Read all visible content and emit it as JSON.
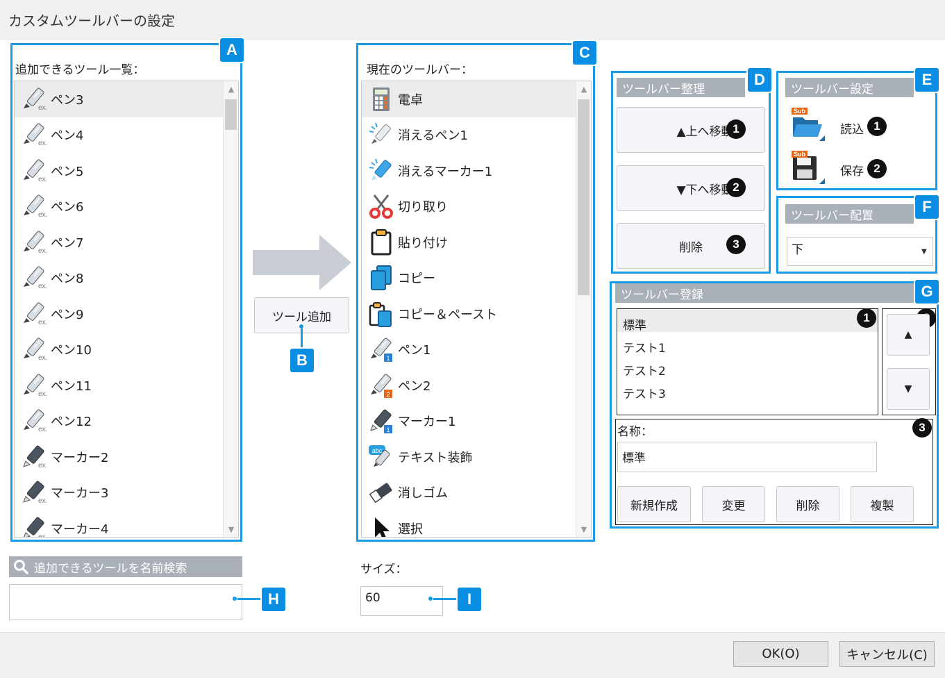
{
  "window": {
    "title": "カスタムツールバーの設定"
  },
  "available": {
    "label": "追加できるツール一覧：",
    "items": [
      {
        "label": "ペン3",
        "icon": "pen-ex-icon"
      },
      {
        "label": "ペン4",
        "icon": "pen-ex-icon"
      },
      {
        "label": "ペン5",
        "icon": "pen-ex-icon"
      },
      {
        "label": "ペン6",
        "icon": "pen-ex-icon"
      },
      {
        "label": "ペン7",
        "icon": "pen-ex-icon"
      },
      {
        "label": "ペン8",
        "icon": "pen-ex-icon"
      },
      {
        "label": "ペン9",
        "icon": "pen-ex-icon"
      },
      {
        "label": "ペン10",
        "icon": "pen-ex-icon"
      },
      {
        "label": "ペン11",
        "icon": "pen-ex-icon"
      },
      {
        "label": "ペン12",
        "icon": "pen-ex-icon"
      },
      {
        "label": "マーカー2",
        "icon": "marker-ex-icon"
      },
      {
        "label": "マーカー3",
        "icon": "marker-ex-icon"
      },
      {
        "label": "マーカー4",
        "icon": "marker-ex-icon"
      }
    ]
  },
  "add_button": {
    "label": "ツール追加"
  },
  "current": {
    "label": "現在のツールバー：",
    "items": [
      {
        "label": "電卓",
        "icon": "calculator-icon"
      },
      {
        "label": "消えるペン1",
        "icon": "vanishing-pen-icon"
      },
      {
        "label": "消えるマーカー1",
        "icon": "vanishing-marker-icon"
      },
      {
        "label": "切り取り",
        "icon": "scissors-icon"
      },
      {
        "label": "貼り付け",
        "icon": "paste-icon"
      },
      {
        "label": "コピー",
        "icon": "copy-icon"
      },
      {
        "label": "コピー＆ペースト",
        "icon": "copy-paste-icon"
      },
      {
        "label": "ペン1",
        "icon": "pen-1-icon"
      },
      {
        "label": "ペン2",
        "icon": "pen-2-icon"
      },
      {
        "label": "マーカー1",
        "icon": "marker-1-icon"
      },
      {
        "label": "テキスト装飾",
        "icon": "text-decoration-icon"
      },
      {
        "label": "消しゴム",
        "icon": "eraser-icon"
      },
      {
        "label": "選択",
        "icon": "cursor-arrow-icon"
      }
    ]
  },
  "organize": {
    "header": "ツールバー整理",
    "move_up": "▲上へ移動",
    "move_down": "▼下へ移動",
    "delete": "削除"
  },
  "settings": {
    "header": "ツールバー設定",
    "load": "読込",
    "save": "保存",
    "sub_badge": "Sub"
  },
  "placement": {
    "header": "ツールバー配置",
    "value": "下"
  },
  "register": {
    "header": "ツールバー登録",
    "items": [
      "標準",
      "テスト1",
      "テスト2",
      "テスト3"
    ],
    "name_label": "名称：",
    "name_value": "標準",
    "buttons": {
      "new": "新規作成",
      "change": "変更",
      "delete": "削除",
      "duplicate": "複製"
    },
    "up_arrow": "▲",
    "down_arrow": "▼"
  },
  "search": {
    "label": "追加できるツールを名前検索",
    "value": ""
  },
  "size": {
    "label": "サイズ：",
    "value": "60"
  },
  "footer": {
    "ok": "OK(O)",
    "cancel": "キャンセル(C)"
  },
  "callouts": {
    "A": "A",
    "B": "B",
    "C": "C",
    "D": "D",
    "E": "E",
    "F": "F",
    "G": "G",
    "H": "H",
    "I": "I"
  },
  "numbers": {
    "n1": "1",
    "n2": "2",
    "n3": "3"
  },
  "colors": {
    "accent": "#1a9be6",
    "badge": "#0a8ee3",
    "group_header": "#a9b0b8"
  }
}
